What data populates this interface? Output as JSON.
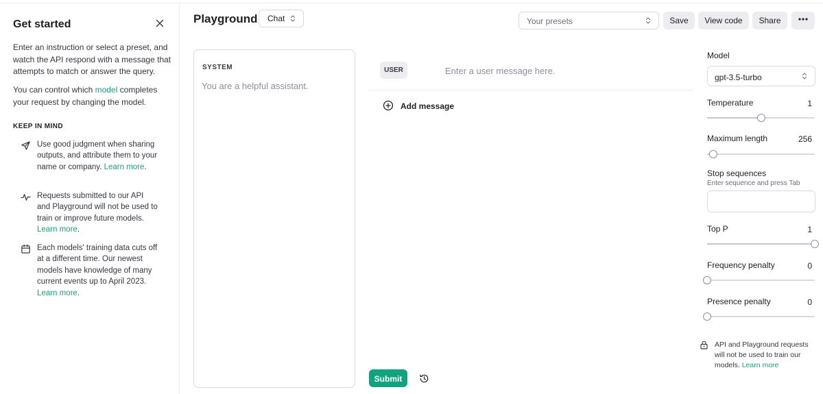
{
  "sidebar": {
    "title": "Get started",
    "intro": "Enter an instruction or select a preset, and watch the API respond with a message that attempts to match or answer the query.",
    "model_p_before": "You can control which ",
    "model_link": "model",
    "model_p_after": " completes your request by changing the model.",
    "keep_in_mind": "KEEP IN MIND",
    "tips": [
      {
        "icon": "send-icon",
        "text": "Use good judgment when sharing outputs, and attribute them to your name or company.",
        "link": "Learn more",
        "suffix": "."
      },
      {
        "icon": "activity-icon",
        "text": "Requests submitted to our API and Playground will not be used to train or improve future models.",
        "link": "Learn more",
        "suffix": "."
      },
      {
        "icon": "calendar-icon",
        "text": "Each models' training data cuts off at a different time. Our newest models have knowledge of many current events up to April 2023.",
        "link": "Learn more",
        "suffix": "."
      }
    ]
  },
  "header": {
    "title": "Playground",
    "mode": "Chat",
    "presets_placeholder": "Your presets",
    "save_label": "Save",
    "view_code_label": "View code",
    "share_label": "Share"
  },
  "system": {
    "label": "SYSTEM",
    "placeholder": "You are a helpful assistant."
  },
  "messages": [
    {
      "role": "USER",
      "placeholder": "Enter a user message here."
    }
  ],
  "add_message_label": "Add message",
  "submit_label": "Submit",
  "settings": {
    "model_label": "Model",
    "model_value": "gpt-3.5-turbo",
    "temperature": {
      "label": "Temperature",
      "value": "1",
      "fraction": 0.5
    },
    "max_length": {
      "label": "Maximum length",
      "value": "256",
      "fraction": 0.06
    },
    "stop_label": "Stop sequences",
    "stop_hint": "Enter sequence and press Tab",
    "top_p": {
      "label": "Top P",
      "value": "1",
      "fraction": 1.0
    },
    "frequency_penalty": {
      "label": "Frequency penalty",
      "value": "0",
      "fraction": 0.0
    },
    "presence_penalty": {
      "label": "Presence penalty",
      "value": "0",
      "fraction": 0.0
    }
  },
  "notice": {
    "text": "API and Playground requests will not be used to train our models.",
    "link": "Learn more"
  },
  "colors": {
    "accent": "#10a37f",
    "border": "#d9d9e3",
    "muted": "#8e8ea0"
  }
}
